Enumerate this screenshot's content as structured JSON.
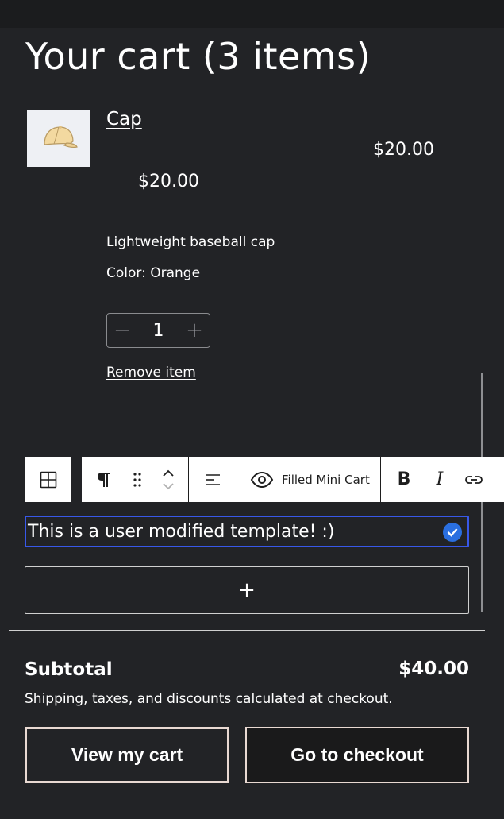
{
  "cart": {
    "title": "Your cart (3 items)",
    "item": {
      "name": "Cap",
      "line_total": "$20.00",
      "unit_price": "$20.00",
      "description": "Lightweight baseball cap",
      "color": "Color: Orange",
      "quantity": "1",
      "minus": "−",
      "plus": "+",
      "remove_label": "Remove item"
    }
  },
  "toolbar": {
    "block_icon": "table-icon",
    "paragraph_icon": "pilcrow-icon",
    "drag_icon": "drag-handle-icon",
    "move_icon": "move-up-down-icon",
    "align_icon": "align-left-icon",
    "preview_icon": "eye-icon",
    "preview_label": "Filled Mini Cart",
    "bold_icon": "bold-icon",
    "italic_icon": "italic-icon",
    "link_icon": "link-icon"
  },
  "editor": {
    "text": "This is a user modified template! :)",
    "appender_label": "+"
  },
  "summary": {
    "subtotal_label": "Subtotal",
    "subtotal_value": "$40.00",
    "shipping_note": "Shipping, taxes, and discounts calculated at checkout.",
    "view_cart_label": "View my cart",
    "checkout_label": "Go to checkout"
  },
  "colors": {
    "background": "#222326",
    "selection": "#3858e9",
    "button_border": "#e9d9d2"
  }
}
